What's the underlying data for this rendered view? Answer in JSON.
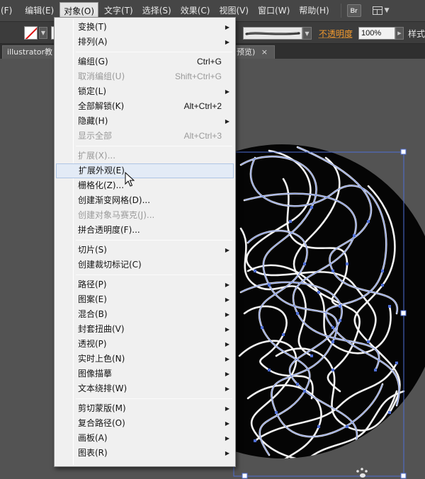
{
  "menubar": {
    "items": [
      {
        "label": "(F)"
      },
      {
        "label": "编辑(E)"
      },
      {
        "label": "对象(O)"
      },
      {
        "label": "文字(T)"
      },
      {
        "label": "选择(S)"
      },
      {
        "label": "效果(C)"
      },
      {
        "label": "视图(V)"
      },
      {
        "label": "窗口(W)"
      },
      {
        "label": "帮助(H)"
      }
    ],
    "active_item": "对象(O)",
    "bridge_label": "Br",
    "workspace_icon": "workspace-switcher-icon"
  },
  "controlbar": {
    "fill_icon": "fill-none-swatch-icon",
    "opacity_label": "不透明度",
    "opacity_value": "100%",
    "style_label": "样式"
  },
  "document_tab": {
    "title": "illustrator教",
    "title_tail": "预览)",
    "close_symbol": "×"
  },
  "object_menu": {
    "items": [
      {
        "label": "变换(T)",
        "shortcut": "",
        "submenu": true,
        "disabled": false
      },
      {
        "label": "排列(A)",
        "shortcut": "",
        "submenu": true,
        "disabled": false
      },
      {
        "type": "divider"
      },
      {
        "label": "编组(G)",
        "shortcut": "Ctrl+G",
        "submenu": false,
        "disabled": false
      },
      {
        "label": "取消编组(U)",
        "shortcut": "Shift+Ctrl+G",
        "submenu": false,
        "disabled": true
      },
      {
        "label": "锁定(L)",
        "shortcut": "",
        "submenu": true,
        "disabled": false
      },
      {
        "label": "全部解锁(K)",
        "shortcut": "Alt+Ctrl+2",
        "submenu": false,
        "disabled": false
      },
      {
        "label": "隐藏(H)",
        "shortcut": "",
        "submenu": true,
        "disabled": false
      },
      {
        "label": "显示全部",
        "shortcut": "Alt+Ctrl+3",
        "submenu": false,
        "disabled": true
      },
      {
        "type": "divider"
      },
      {
        "label": "扩展(X)...",
        "shortcut": "",
        "submenu": false,
        "disabled": true
      },
      {
        "label": "扩展外观(E)",
        "shortcut": "",
        "submenu": false,
        "disabled": false,
        "hover": true
      },
      {
        "label": "栅格化(Z)...",
        "shortcut": "",
        "submenu": false,
        "disabled": false
      },
      {
        "label": "创建渐变网格(D)...",
        "shortcut": "",
        "submenu": false,
        "disabled": false
      },
      {
        "label": "创建对象马赛克(J)...",
        "shortcut": "",
        "submenu": false,
        "disabled": true
      },
      {
        "label": "拼合透明度(F)...",
        "shortcut": "",
        "submenu": false,
        "disabled": false
      },
      {
        "type": "divider"
      },
      {
        "label": "切片(S)",
        "shortcut": "",
        "submenu": true,
        "disabled": false
      },
      {
        "label": "创建裁切标记(C)",
        "shortcut": "",
        "submenu": false,
        "disabled": false
      },
      {
        "type": "divider"
      },
      {
        "label": "路径(P)",
        "shortcut": "",
        "submenu": true,
        "disabled": false
      },
      {
        "label": "图案(E)",
        "shortcut": "",
        "submenu": true,
        "disabled": false
      },
      {
        "label": "混合(B)",
        "shortcut": "",
        "submenu": true,
        "disabled": false
      },
      {
        "label": "封套扭曲(V)",
        "shortcut": "",
        "submenu": true,
        "disabled": false
      },
      {
        "label": "透视(P)",
        "shortcut": "",
        "submenu": true,
        "disabled": false
      },
      {
        "label": "实时上色(N)",
        "shortcut": "",
        "submenu": true,
        "disabled": false
      },
      {
        "label": "图像描摹",
        "shortcut": "",
        "submenu": true,
        "disabled": false
      },
      {
        "label": "文本绕排(W)",
        "shortcut": "",
        "submenu": true,
        "disabled": false
      },
      {
        "type": "divider"
      },
      {
        "label": "剪切蒙版(M)",
        "shortcut": "",
        "submenu": true,
        "disabled": false
      },
      {
        "label": "复合路径(O)",
        "shortcut": "",
        "submenu": true,
        "disabled": false
      },
      {
        "label": "画板(A)",
        "shortcut": "",
        "submenu": true,
        "disabled": false
      },
      {
        "label": "图表(R)",
        "shortcut": "",
        "submenu": true,
        "disabled": false
      }
    ]
  },
  "colors": {
    "app_bg": "#535353",
    "menu_bg": "#f0f0f0",
    "selection_blue": "#4f6fd6",
    "opacity_label": "#f29a2e"
  }
}
